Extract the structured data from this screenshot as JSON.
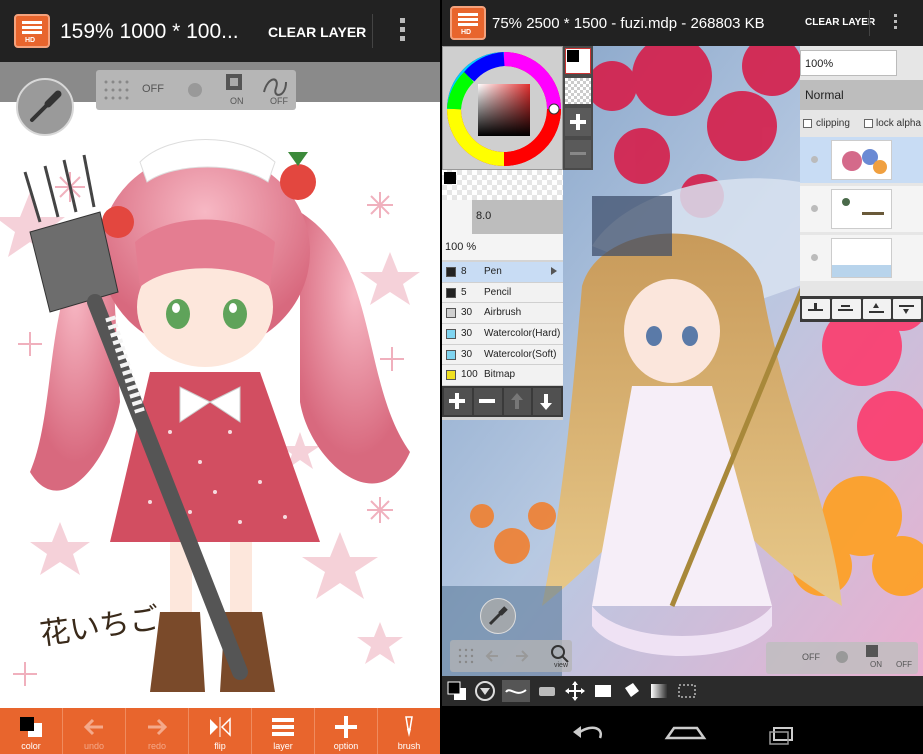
{
  "left_app": {
    "title": "159% 1000 * 100...",
    "clear_layer": "CLEAR LAYER",
    "logo_text": "HD",
    "toggles": [
      {
        "label": "OFF"
      },
      {
        "label": "ON"
      },
      {
        "label": "OFF"
      }
    ],
    "signature": "花いちご",
    "bottom_bar": [
      {
        "label": "color",
        "icon": "color-swatch-icon",
        "enabled": true
      },
      {
        "label": "undo",
        "icon": "undo-arrow-icon",
        "enabled": false
      },
      {
        "label": "redo",
        "icon": "redo-arrow-icon",
        "enabled": false
      },
      {
        "label": "flip",
        "icon": "flip-icon",
        "enabled": true
      },
      {
        "label": "layer",
        "icon": "layer-icon",
        "enabled": true
      },
      {
        "label": "option",
        "icon": "plus-icon",
        "enabled": true
      },
      {
        "label": "brush",
        "icon": "brush-icon",
        "enabled": true
      }
    ]
  },
  "right_app": {
    "title": "75% 2500 * 1500 - fuzi.mdp - 268803 KB",
    "clear_layer": "CLEAR LAYER",
    "logo_text": "HD",
    "brush_size": "8.0",
    "brush_opacity": "100 %",
    "brushes": [
      {
        "size": "8",
        "name": "Pen",
        "color": "#222222",
        "selected": true
      },
      {
        "size": "5",
        "name": "Pencil",
        "color": "#222222",
        "selected": false
      },
      {
        "size": "30",
        "name": "Airbrush",
        "color": "#cfcfcf",
        "selected": false
      },
      {
        "size": "30",
        "name": "Watercolor(Hard)",
        "color": "#7fd4f0",
        "selected": false
      },
      {
        "size": "30",
        "name": "Watercolor(Soft)",
        "color": "#7fd4f0",
        "selected": false
      },
      {
        "size": "100",
        "name": "Bitmap",
        "color": "#f0e020",
        "selected": false
      }
    ],
    "layer_panel": {
      "opacity": "100%",
      "blend_mode": "Normal",
      "clipping_label": "clipping",
      "lock_alpha_label": "lock alpha"
    },
    "nav_view_label": "view",
    "toggles": [
      {
        "label": "OFF"
      },
      {
        "label": "ON"
      },
      {
        "label": "OFF"
      }
    ]
  },
  "colors": {
    "accent_orange": "#e8652d",
    "topbar": "#222222",
    "selection_blue": "#c8dcf4"
  }
}
